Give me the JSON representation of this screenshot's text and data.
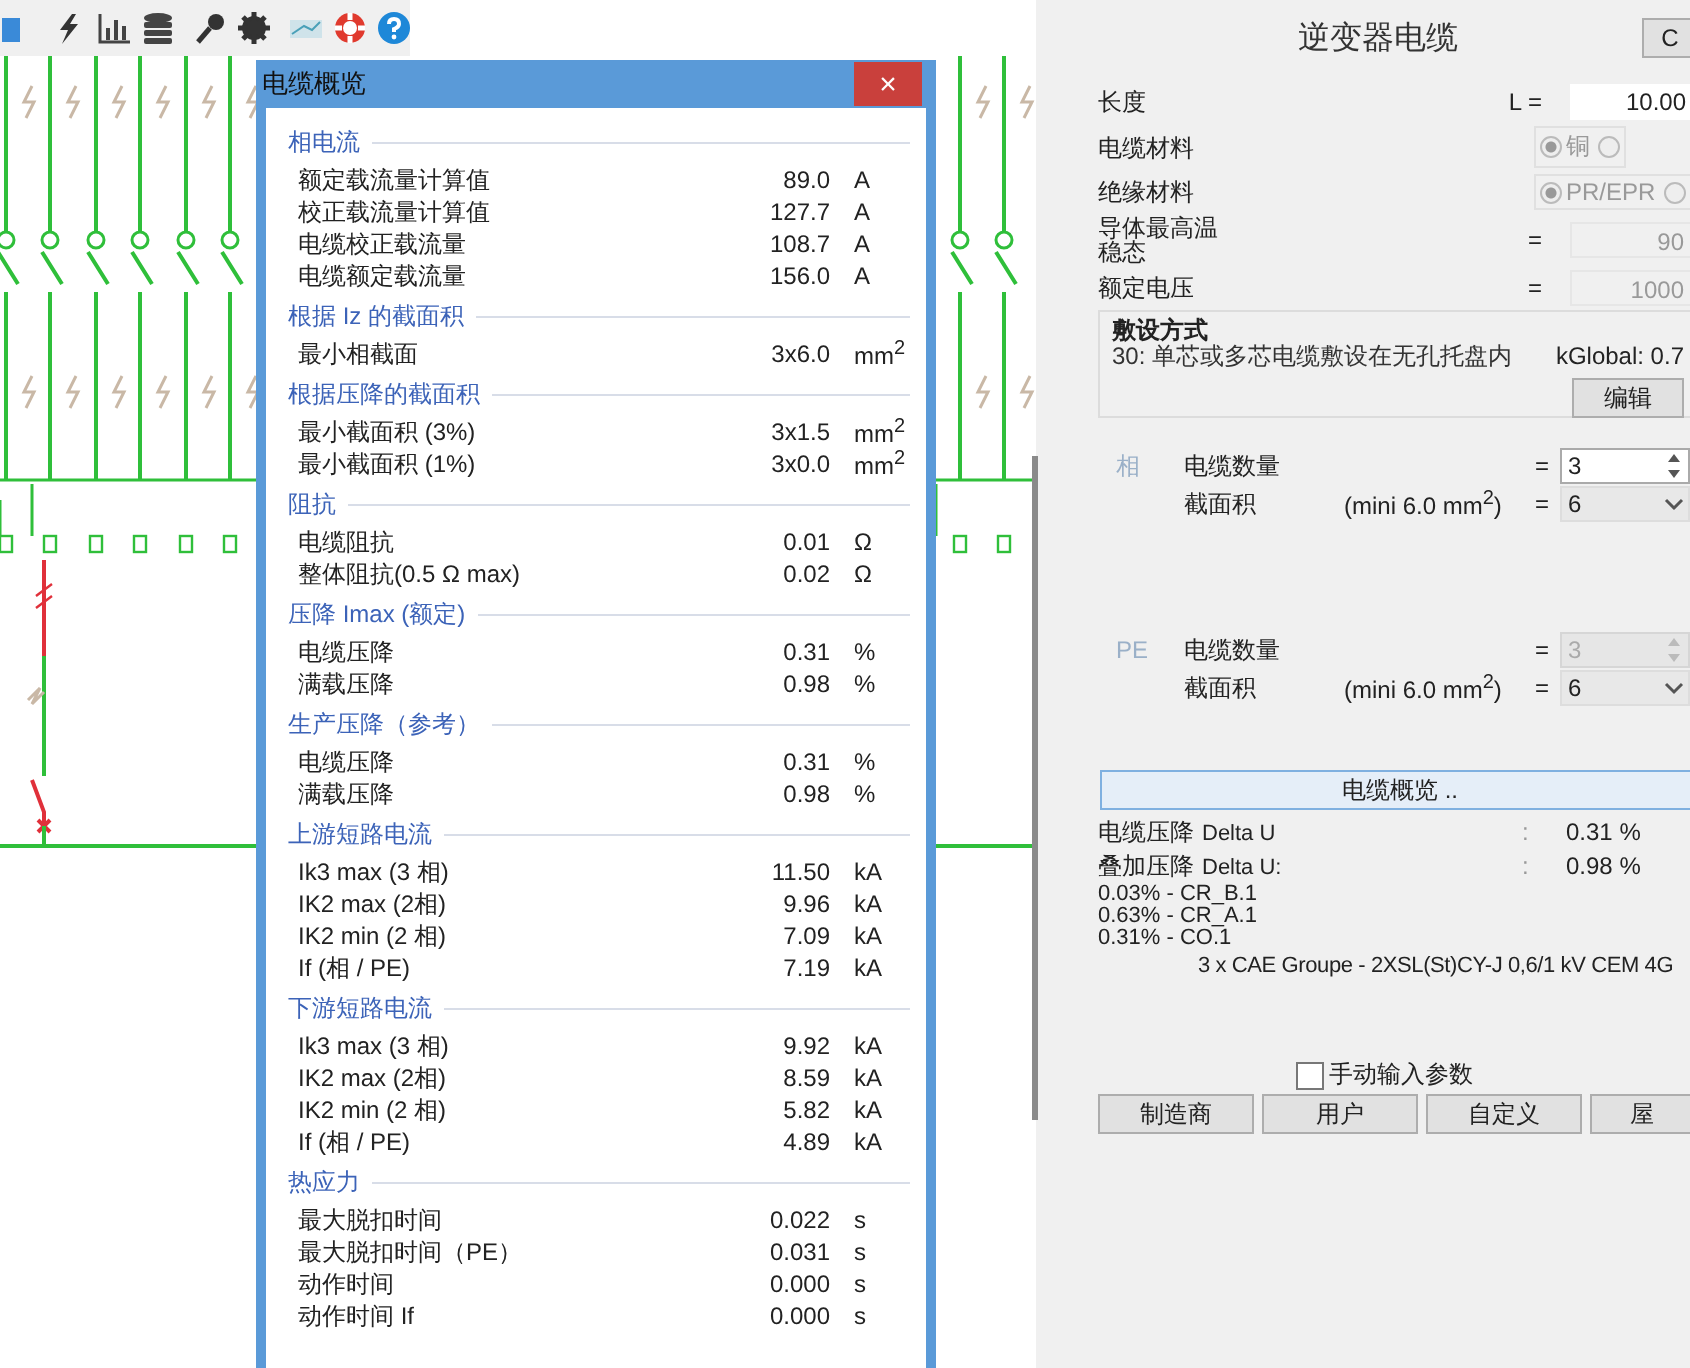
{
  "dialog": {
    "title": "电缆概览",
    "close": "×",
    "sections": [
      {
        "heading": "相电流",
        "rows": [
          {
            "label": "额定载流量计算值",
            "value": "89.0",
            "unit": "A"
          },
          {
            "label": "校正载流量计算值",
            "value": "127.7",
            "unit": "A"
          },
          {
            "label": "电缆校正载流量",
            "value": "108.7",
            "unit": "A"
          },
          {
            "label": "电缆额定载流量",
            "value": "156.0",
            "unit": "A"
          }
        ]
      },
      {
        "heading": "根据 Iz 的截面积",
        "rows": [
          {
            "label": "最小相截面",
            "value": "3x6.0",
            "unit": "mm$^{2}$"
          }
        ]
      },
      {
        "heading": "根据压降的截面积",
        "rows": [
          {
            "label": "最小截面积 (3%)",
            "value": "3x1.5",
            "unit": "mm$^{2}$"
          },
          {
            "label": "最小截面积 (1%)",
            "value": "3x0.0",
            "unit": "mm$^{2}$"
          }
        ]
      },
      {
        "heading": "阻抗",
        "rows": [
          {
            "label": "电缆阻抗",
            "value": "0.01",
            "unit": "Ω"
          },
          {
            "label": "整体阻抗(0.5 Ω max)",
            "value": "0.02",
            "unit": "Ω"
          }
        ]
      },
      {
        "heading": "压降 Imax (额定)",
        "rows": [
          {
            "label": "电缆压降",
            "value": "0.31",
            "unit": "%"
          },
          {
            "label": "满载压降",
            "value": "0.98",
            "unit": "%"
          }
        ]
      },
      {
        "heading": "生产压降（参考）",
        "rows": [
          {
            "label": "电缆压降",
            "value": "0.31",
            "unit": "%"
          },
          {
            "label": "满载压降",
            "value": "0.98",
            "unit": "%"
          }
        ]
      },
      {
        "heading": "上游短路电流",
        "rows": [
          {
            "label": "Ik3 max (3 相)",
            "value": "11.50",
            "unit": "kA"
          },
          {
            "label": "IK2 max (2相)",
            "value": "9.96",
            "unit": "kA"
          },
          {
            "label": "IK2 min (2 相)",
            "value": "7.09",
            "unit": "kA"
          },
          {
            "label": "If (相 / PE)",
            "value": "7.19",
            "unit": "kA"
          }
        ]
      },
      {
        "heading": "下游短路电流",
        "rows": [
          {
            "label": "Ik3 max (3 相)",
            "value": "9.92",
            "unit": "kA"
          },
          {
            "label": "IK2 max (2相)",
            "value": "8.59",
            "unit": "kA"
          },
          {
            "label": "IK2 min (2 相)",
            "value": "5.82",
            "unit": "kA"
          },
          {
            "label": "If (相 / PE)",
            "value": "4.89",
            "unit": "kA"
          }
        ]
      },
      {
        "heading": "热应力",
        "rows": [
          {
            "label": "最大脱扣时间",
            "value": "0.022",
            "unit": "s"
          },
          {
            "label": "最大脱扣时间（PE）",
            "value": "0.031",
            "unit": "s"
          },
          {
            "label": "动作时间",
            "value": "0.000",
            "unit": "s"
          },
          {
            "label": "动作时间 If",
            "value": "0.000",
            "unit": "s"
          }
        ]
      }
    ]
  },
  "panel": {
    "title": "逆变器电缆",
    "corner_button": "C",
    "params": [
      {
        "kind": "field",
        "label": "长度",
        "prefix": "L =",
        "value": "10.00",
        "disabled": false
      },
      {
        "kind": "radio",
        "label": "电缆材料",
        "options": [
          {
            "label": "铜",
            "selected": true
          },
          {
            "selected": false
          }
        ]
      },
      {
        "kind": "radio",
        "label": "绝缘材料",
        "options": [
          {
            "label": "PR/EPR",
            "selected": true
          },
          {
            "selected": false
          }
        ]
      },
      {
        "kind": "field",
        "label_lines": [
          "导体最高温",
          "稳态"
        ],
        "prefix": "=",
        "value": "90",
        "disabled": true
      },
      {
        "kind": "field",
        "label": "额定电压",
        "prefix": "=",
        "value": "1000",
        "disabled": true
      }
    ],
    "laying": {
      "heading": "敷设方式",
      "method": "30: 单芯或多芯电缆敷设在无孔托盘内",
      "k_global": "kGlobal: 0.7",
      "button": "编辑"
    },
    "conductors": [
      {
        "tag": "相",
        "rows": [
          {
            "kind": "spinner",
            "label": "电缆数量",
            "eq": "=",
            "value": "3",
            "disabled": false
          },
          {
            "kind": "dropdown",
            "label": "截面积",
            "hint": "(mini 6.0 mm$^{2}$)",
            "eq": "=",
            "value": "6"
          }
        ]
      },
      {
        "tag": "PE",
        "rows": [
          {
            "kind": "spinner",
            "label": "电缆数量",
            "eq": "=",
            "value": "3",
            "disabled": true
          },
          {
            "kind": "dropdown",
            "label": "截面积",
            "hint": "(mini 6.0 mm$^{2}$)",
            "eq": "=",
            "value": "6"
          }
        ]
      }
    ],
    "overview_button": "电缆概览 ..",
    "drops": [
      {
        "label": "电缆压降",
        "sub": "Delta U",
        "sep": ":",
        "value": "0.31 %"
      },
      {
        "label": "叠加压降",
        "sub": "Delta U:",
        "sep": ":",
        "value": "0.98 %"
      }
    ],
    "contributions": [
      "0.03% - CR_B.1",
      "0.63% - CR_A.1",
      "0.31% - CO.1"
    ],
    "cable_ref": "3 x CAE Groupe - 2XSL(St)CY-J 0,6/1 kV CEM 4G",
    "manual": {
      "label": "手动输入参数",
      "checked": false
    },
    "buttons": [
      "制造商",
      "用户",
      "自定义",
      "屋"
    ]
  }
}
